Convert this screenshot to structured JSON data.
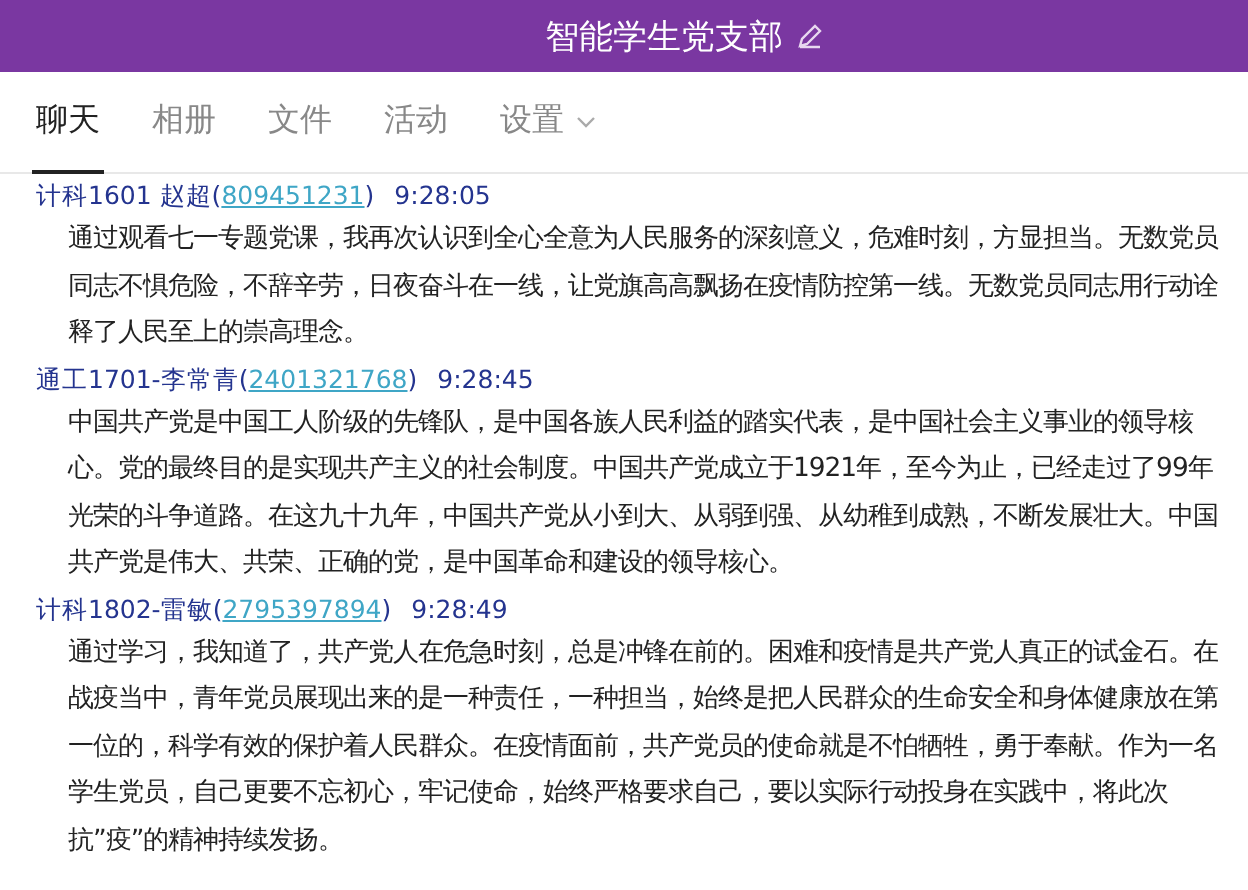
{
  "window": {
    "title": "智能学生党支部"
  },
  "tabs": [
    {
      "label": "聊天",
      "selected": true,
      "has_menu": false
    },
    {
      "label": "相册",
      "selected": false,
      "has_menu": false
    },
    {
      "label": "文件",
      "selected": false,
      "has_menu": false
    },
    {
      "label": "活动",
      "selected": false,
      "has_menu": false
    },
    {
      "label": "设置",
      "selected": false,
      "has_menu": true
    }
  ],
  "messages": [
    {
      "sender": "计科1601 赵超",
      "open": "(",
      "id": "809451231",
      "close": ")",
      "time": "9:28:05",
      "text": "通过观看七一专题党课，我再次认识到全心全意为人民服务的深刻意义，危难时刻，方显担当。无数党员同志不惧危险，不辞辛劳，日夜奋斗在一线，让党旗高高飘扬在疫情防控第一线。无数党员同志用行动诠释了人民至上的崇高理念。"
    },
    {
      "sender": "通工1701-李常青",
      "open": "(",
      "id": "2401321768",
      "close": ")",
      "time": "9:28:45",
      "text": "中国共产党是中国工人阶级的先锋队，是中国各族人民利益的踏实代表，是中国社会主义事业的领导核心。党的最终目的是实现共产主义的社会制度。中国共产党成立于1921年，至今为止，已经走过了99年光荣的斗争道路。在这九十九年，中国共产党从小到大、从弱到强、从幼稚到成熟，不断发展壮大。中国共产党是伟大、共荣、正确的党，是中国革命和建设的领导核心。"
    },
    {
      "sender": "计科1802-雷敏",
      "open": "(",
      "id": "2795397894",
      "close": ")",
      "time": "9:28:49",
      "text": "通过学习，我知道了，共产党人在危急时刻，总是冲锋在前的。困难和疫情是共产党人真正的试金石。在战疫当中，青年党员展现出来的是一种责任，一种担当，始终是把人民群众的生命安全和身体健康放在第一位的，科学有效的保护着人民群众。在疫情面前，共产党员的使命就是不怕牺牲，勇于奉献。作为一名学生党员，自己更要不忘初心，牢记使命，始终严格要求自己，要以实际行动投身在实践中，将此次抗”疫”的精神持续发扬。"
    }
  ]
}
